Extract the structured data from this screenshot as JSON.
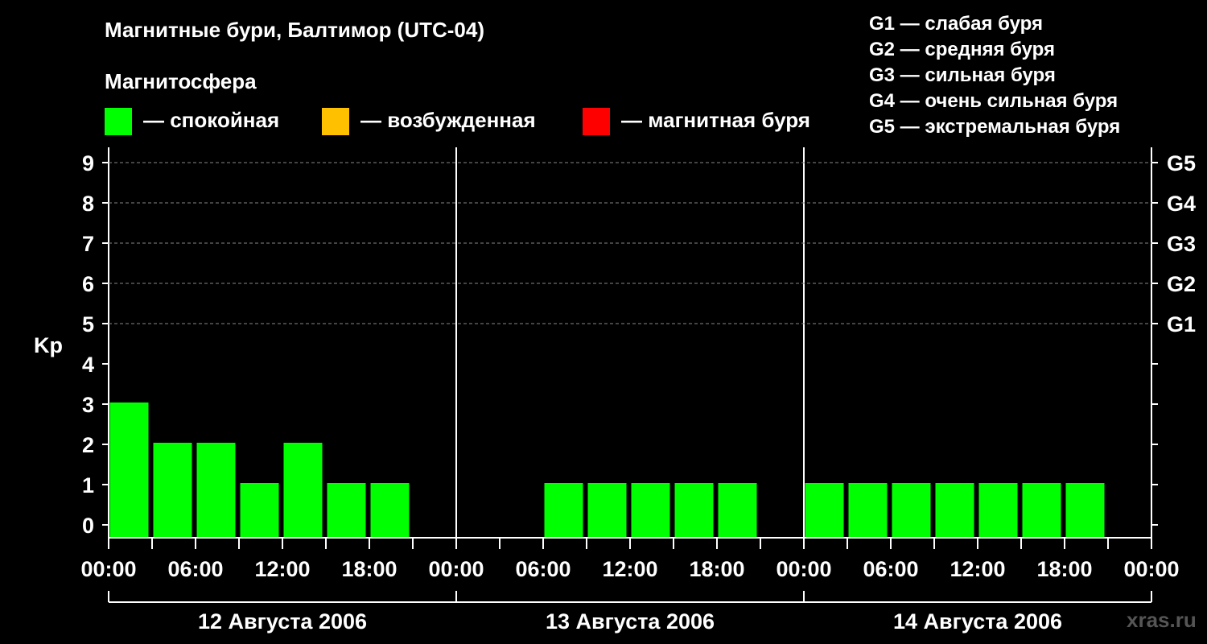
{
  "title": "Магнитные бури, Балтимор (UTC-04)",
  "subtitle": "Магнитосфера",
  "legend": [
    {
      "color": "#00ff00",
      "label": "— спокойная"
    },
    {
      "color": "#ffc000",
      "label": "— возбужденная"
    },
    {
      "color": "#ff0000",
      "label": "— магнитная буря"
    }
  ],
  "g_legend": [
    "G1 — слабая буря",
    "G2 — средняя буря",
    "G3 — сильная буря",
    "G4 — очень сильная буря",
    "G5 — экстремальная буря"
  ],
  "watermark": "xras.ru",
  "chart_data": {
    "type": "bar",
    "ylabel": "Kp",
    "ylim": [
      0,
      9
    ],
    "yticks": [
      0,
      1,
      2,
      3,
      4,
      5,
      6,
      7,
      8,
      9
    ],
    "g_levels": [
      {
        "label": "G1",
        "kp": 5
      },
      {
        "label": "G2",
        "kp": 6
      },
      {
        "label": "G3",
        "kp": 7
      },
      {
        "label": "G4",
        "kp": 8
      },
      {
        "label": "G5",
        "kp": 9
      }
    ],
    "days": [
      "12 Августа 2006",
      "13 Августа 2006",
      "14 Августа 2006"
    ],
    "xtick_labels": [
      "00:00",
      "06:00",
      "12:00",
      "18:00",
      "00:00",
      "06:00",
      "12:00",
      "18:00",
      "00:00",
      "06:00",
      "12:00",
      "18:00",
      "00:00"
    ],
    "bar_hours": [
      3,
      3,
      3,
      3,
      3,
      3,
      3,
      3
    ],
    "series": [
      {
        "values": [
          [
            3,
            2,
            2,
            1,
            2,
            1,
            1,
            null
          ],
          [
            null,
            null,
            1,
            1,
            1,
            1,
            1,
            null
          ],
          [
            1,
            1,
            1,
            1,
            1,
            1,
            1,
            null
          ]
        ]
      }
    ],
    "colors": {
      "quiet": "#00ff00",
      "active": "#ffc000",
      "storm": "#ff0000"
    },
    "grid": true
  }
}
